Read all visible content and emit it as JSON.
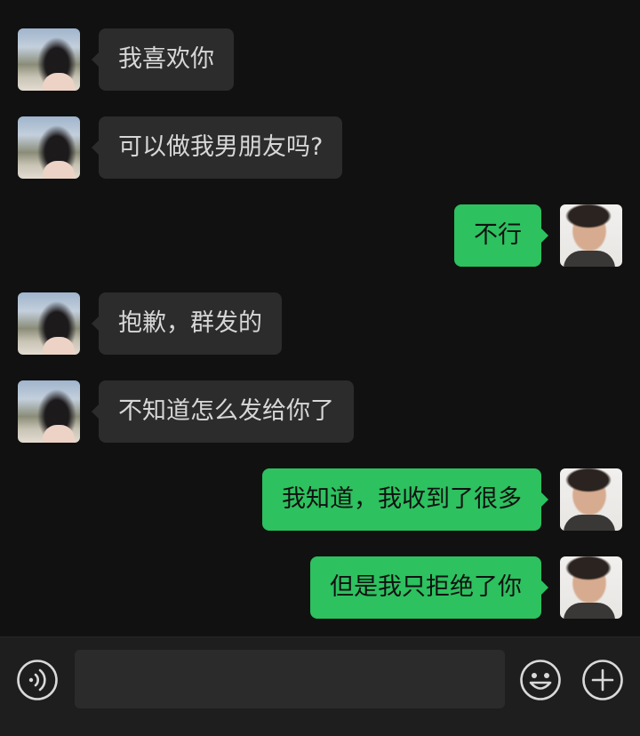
{
  "chat": {
    "messages": [
      {
        "side": "left",
        "text": "我喜欢你"
      },
      {
        "side": "left",
        "text": "可以做我男朋友吗?"
      },
      {
        "side": "right",
        "text": "不行"
      },
      {
        "side": "left",
        "text": "抱歉，群发的"
      },
      {
        "side": "left",
        "text": "不知道怎么发给你了"
      },
      {
        "side": "right",
        "text": "我知道，我收到了很多"
      },
      {
        "side": "right",
        "text": "但是我只拒绝了你"
      }
    ]
  },
  "input_bar": {
    "text_value": "",
    "icons": {
      "voice": "voice-icon",
      "emoji": "emoji-icon",
      "more": "plus-icon"
    }
  },
  "colors": {
    "background": "#111111",
    "incoming_bubble": "#2c2c2c",
    "outgoing_bubble": "#2dc15f",
    "incoming_text": "#d7d7d7",
    "outgoing_text": "#111111",
    "input_bar": "#1e1e1e"
  }
}
